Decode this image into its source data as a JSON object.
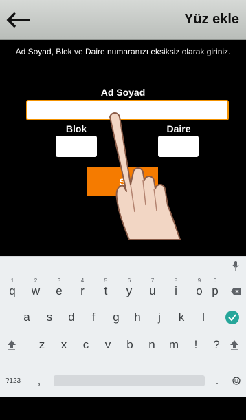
{
  "header": {
    "title": "Yüz ekle",
    "back_icon": "back-arrow-icon"
  },
  "form": {
    "instructions": "Ad Soyad, Blok ve Daire numaranızı eksiksiz olarak giriniz.",
    "name_label": "Ad Soyad",
    "name_value": "",
    "blok_label": "Blok",
    "blok_value": "",
    "daire_label": "Daire",
    "daire_value": "",
    "submit_label": "S"
  },
  "keyboard": {
    "row1": [
      {
        "key": "q",
        "hint": "1"
      },
      {
        "key": "w",
        "hint": "2"
      },
      {
        "key": "e",
        "hint": "3"
      },
      {
        "key": "r",
        "hint": "4"
      },
      {
        "key": "t",
        "hint": "5"
      },
      {
        "key": "y",
        "hint": "6"
      },
      {
        "key": "u",
        "hint": "7"
      },
      {
        "key": "i",
        "hint": "8"
      },
      {
        "key": "o",
        "hint": "9"
      },
      {
        "key": "p",
        "hint": "0"
      }
    ],
    "row2": [
      "a",
      "s",
      "d",
      "f",
      "g",
      "h",
      "j",
      "k",
      "l"
    ],
    "row3": [
      "z",
      "x",
      "c",
      "v",
      "b",
      "n",
      "m",
      "!",
      "?"
    ],
    "row4": {
      "symbols": "?123",
      "comma": ",",
      "period": "."
    },
    "icons": [
      "mic-icon",
      "backspace-icon",
      "enter-icon",
      "shift-icon",
      "emoji-icon"
    ],
    "accent": "#26a69a"
  },
  "colors": {
    "accent_orange": "#f57b00",
    "header_bg": "#c8cbc8"
  }
}
